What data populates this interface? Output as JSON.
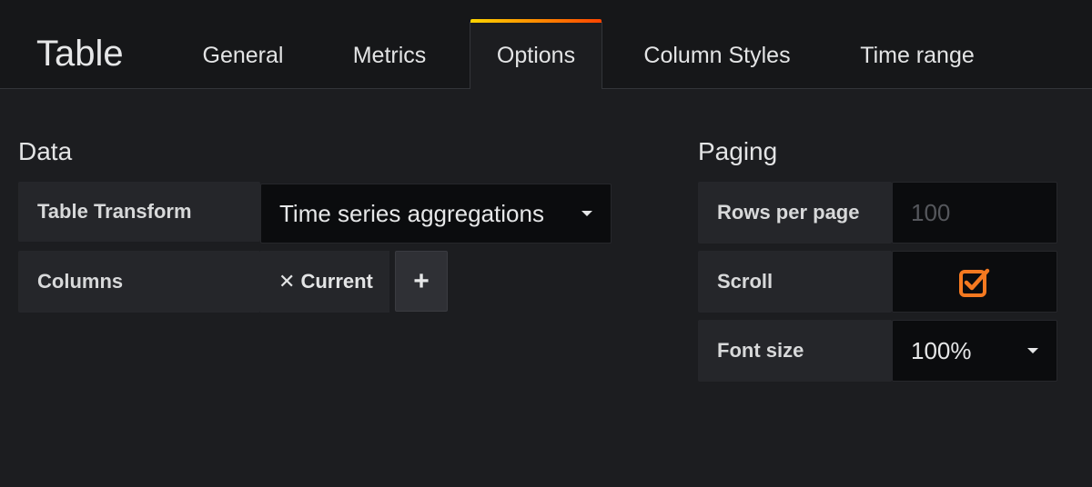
{
  "panel": {
    "title": "Table"
  },
  "tabs": [
    {
      "label": "General"
    },
    {
      "label": "Metrics"
    },
    {
      "label": "Options",
      "active": true
    },
    {
      "label": "Column Styles"
    },
    {
      "label": "Time range"
    }
  ],
  "data_section": {
    "title": "Data",
    "table_transform": {
      "label": "Table Transform",
      "value": "Time series aggregations"
    },
    "columns": {
      "label": "Columns",
      "chips": [
        "Current"
      ],
      "add_label": "+"
    }
  },
  "paging_section": {
    "title": "Paging",
    "rows_per_page": {
      "label": "Rows per page",
      "placeholder": "100",
      "value": ""
    },
    "scroll": {
      "label": "Scroll",
      "checked": true
    },
    "font_size": {
      "label": "Font size",
      "value": "100%"
    }
  },
  "colors": {
    "accent": "#f57920",
    "tab_gradient_start": "#ffd500",
    "tab_gradient_end": "#ff4400"
  },
  "icons": {
    "chip_remove": "times-icon",
    "dropdown": "caret-down-icon",
    "checkbox": "checkbox-checked-icon"
  }
}
